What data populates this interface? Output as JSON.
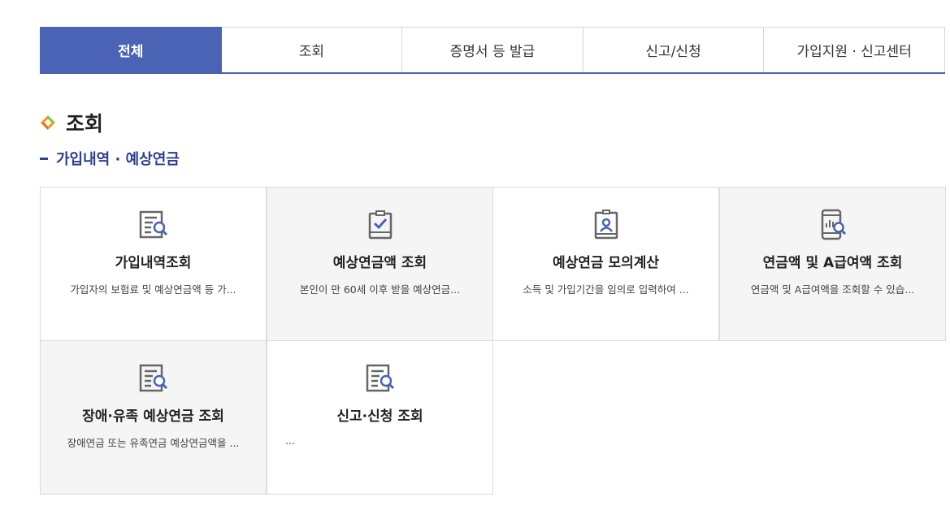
{
  "tabs": [
    {
      "label": "전체",
      "active": true
    },
    {
      "label": "조회",
      "active": false
    },
    {
      "label": "증명서 등 발급",
      "active": false
    },
    {
      "label": "신고/신청",
      "active": false
    },
    {
      "label": "가입지원 · 신고센터",
      "active": false
    }
  ],
  "section": {
    "title": "조회"
  },
  "subsection": {
    "title": "가입내역 · 예상연금"
  },
  "cards": [
    {
      "title": "가입내역조회",
      "desc": "가입자의 보험료 및 예상연금액 등 가...",
      "icon": "document-search-icon"
    },
    {
      "title": "예상연금액 조회",
      "desc": "본인이 만 60세 이후 받을 예상연금...",
      "icon": "clipboard-check-icon"
    },
    {
      "title": "예상연금 모의계산",
      "desc": "소득 및 가입기간을 임의로 입력하여 ...",
      "icon": "id-badge-icon"
    },
    {
      "title": "연금액 및 A급여액 조회",
      "desc": "연금액 및 A급여액을 조회할 수 있습...",
      "icon": "mobile-chart-search-icon"
    },
    {
      "title": "장애·유족 예상연금 조회",
      "desc": "장애연금 또는 유족연금 예상연금액을 ...",
      "icon": "document-search-icon"
    },
    {
      "title": "신고·신청 조회",
      "desc": "...",
      "icon": "document-search-icon"
    }
  ],
  "colors": {
    "accent": "#4a63b4",
    "subtitle": "#2d3f8c",
    "icon_gray": "#666666",
    "icon_blue": "#4a63b4"
  }
}
